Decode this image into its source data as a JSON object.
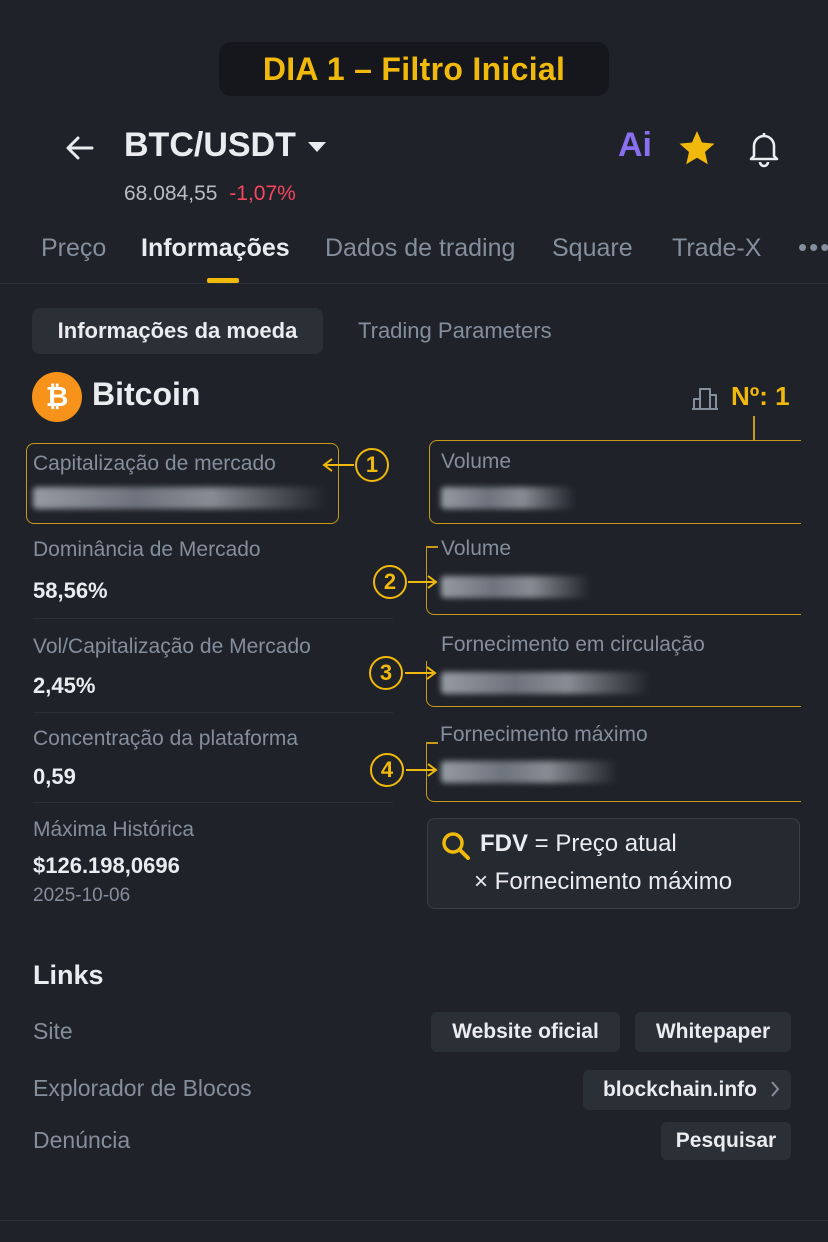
{
  "banner": {
    "text": "DIA 1 – Filtro Inicial"
  },
  "header": {
    "pair": "BTC/USDT",
    "price": "68.084,55",
    "change": "-1,07%",
    "ai_label": "Ai",
    "colors": {
      "up_accent": "#f0b90b",
      "negative": "#f6465d",
      "ai": "#8a6ff0"
    }
  },
  "tabs": [
    {
      "label": "Preço"
    },
    {
      "label": "Informações",
      "active": true
    },
    {
      "label": "Dados de trading"
    },
    {
      "label": "Square"
    },
    {
      "label": "Trade-X"
    }
  ],
  "more_label": "•••",
  "subtabs": {
    "active": "Informações da moeda",
    "other": "Trading Parameters"
  },
  "coin": {
    "name": "Bitcoin",
    "symbol_glyph": "₿",
    "rank": "Nº: 1"
  },
  "left_metrics": {
    "market_cap": {
      "label": "Capitalização de mercado"
    },
    "dominance": {
      "label": "Dominância de Mercado",
      "value": "58,56%"
    },
    "vol_cap": {
      "label": "Vol/Capitalização de Mercado",
      "value": "2,45%"
    },
    "concentration": {
      "label": "Concentração da plataforma",
      "value": "0,59"
    },
    "ath": {
      "label": "Máxima Histórica",
      "value": "$126.198,0696",
      "date": "2025-10-06"
    }
  },
  "right_metrics": {
    "volume_1": {
      "label": "Volume"
    },
    "volume_2": {
      "label": "Volume"
    },
    "circulating": {
      "label": "Fornecimento em circulação"
    },
    "max_supply": {
      "label": "Fornecimento máximo"
    }
  },
  "badges": [
    "1",
    "2",
    "3",
    "4"
  ],
  "fdv": {
    "term": "FDV",
    "line1_rest": " = Preço atual",
    "line2": "× Fornecimento máximo"
  },
  "links": {
    "title": "Links",
    "site_label": "Site",
    "site_buttons": [
      "Website oficial",
      "Whitepaper"
    ],
    "explorer_label": "Explorador de Blocos",
    "explorer_button": "blockchain.info",
    "report_label": "Denúncia",
    "report_button": "Pesquisar"
  }
}
